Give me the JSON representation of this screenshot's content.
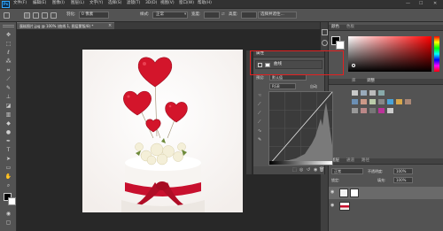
{
  "menubar": {
    "logo": "Ps",
    "items": [
      "文件(F)",
      "编辑(E)",
      "图像(I)",
      "图层(L)",
      "文字(Y)",
      "选择(S)",
      "滤镜(T)",
      "3D(D)",
      "视图(V)",
      "窗口(W)",
      "帮助(H)"
    ],
    "window_controls": [
      "—",
      "☐",
      "✕"
    ]
  },
  "optionsbar": {
    "feather_label": "羽化:",
    "feather_value": "0 像素",
    "style_label": "样式:",
    "style_value": "正常",
    "width_label": "宽度:",
    "height_label": "高度:",
    "select_mask_button": "选择并遮住..."
  },
  "document": {
    "tab_title": "蛋糕图片.jpg @ 100% (曲线 1, 图层蒙版/8) *",
    "tab_close": "×"
  },
  "properties": {
    "header": "属性",
    "type_label": "曲线",
    "preset_label": "预设:",
    "preset_value": "默认值",
    "channel_value": "RGB",
    "auto_button": "自动"
  },
  "panels": {
    "color_tabs": [
      "颜色",
      "色板"
    ],
    "adjust_tabs": [
      "库",
      "调整"
    ],
    "layers_tabs": [
      "图层",
      "通道",
      "路径"
    ],
    "blend_mode": "正常",
    "opacity_label": "不透明度:",
    "opacity_value": "100%",
    "fill_label": "填充:",
    "fill_value": "100%",
    "lock_label": "锁定:"
  },
  "colors": {
    "accent_highlight": "#e32121",
    "ps_blue": "#31a8ff",
    "cake_red": "#c8102e"
  },
  "icons": [
    "move-icon",
    "marquee-icon",
    "lasso-icon",
    "magic-wand-icon",
    "crop-icon",
    "eyedropper-icon",
    "brush-icon",
    "clone-stamp-icon",
    "eraser-icon",
    "gradient-icon",
    "blur-icon",
    "dodge-icon",
    "pen-icon",
    "type-icon",
    "path-select-icon",
    "rectangle-icon",
    "hand-icon",
    "zoom-icon"
  ]
}
